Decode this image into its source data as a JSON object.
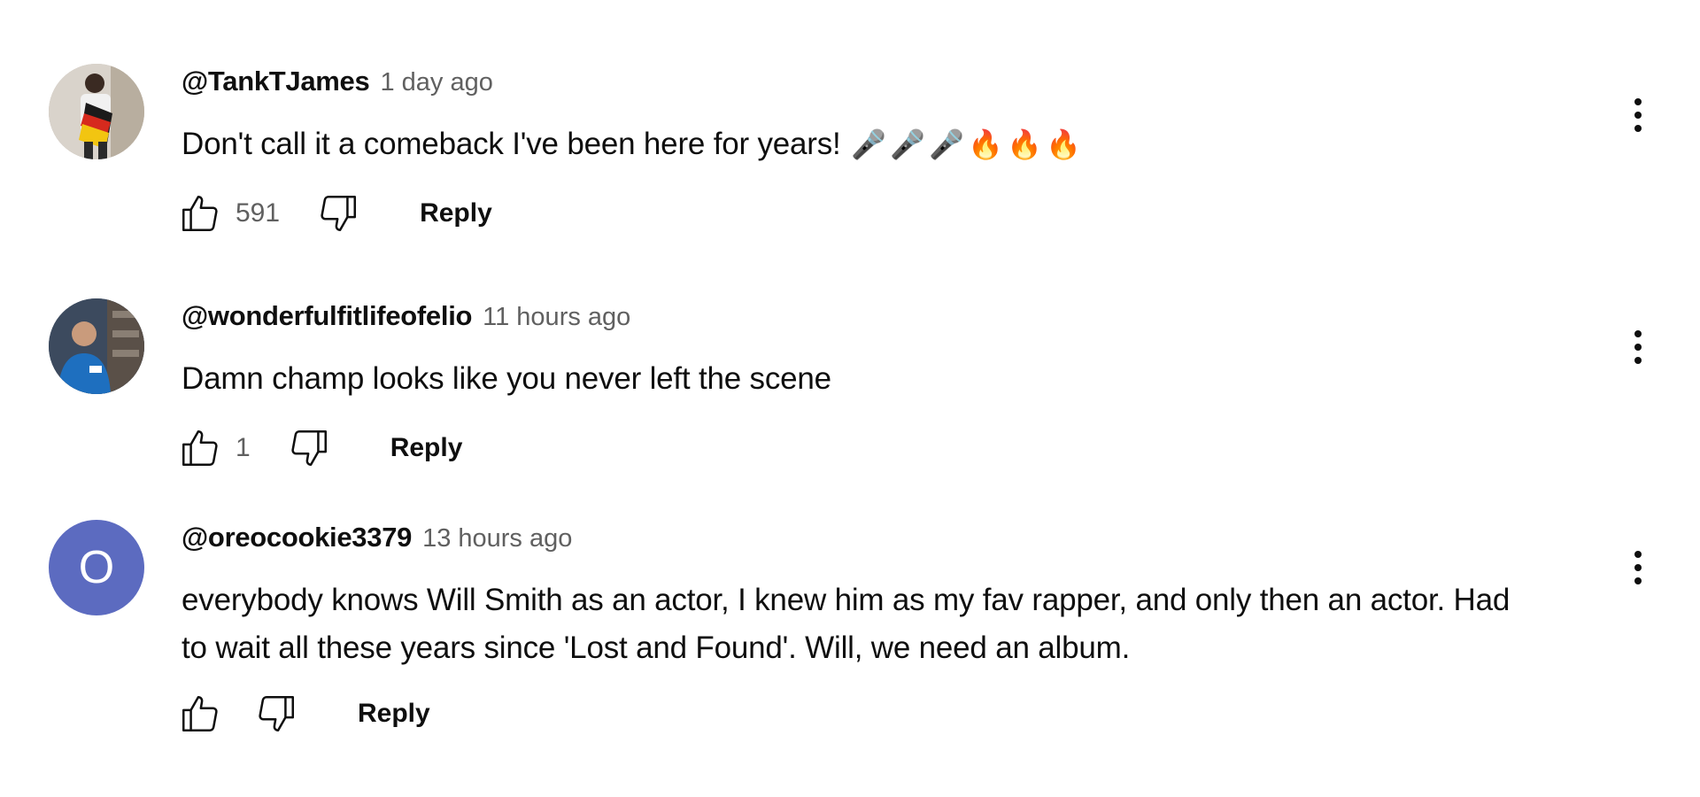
{
  "comments": [
    {
      "author": "@TankTJames",
      "time": "1 day ago",
      "text": "Don't call it a comeback I've been here for years!",
      "emojis": {
        "mic": "🎤",
        "fire": "🔥"
      },
      "likes": "591",
      "reply_label": "Reply",
      "avatar": {
        "type": "photo"
      }
    },
    {
      "author": "@wonderfulfitlifeofelio",
      "time": "11 hours ago",
      "text": "Damn champ looks like you never left the scene",
      "likes": "1",
      "reply_label": "Reply",
      "avatar": {
        "type": "photo"
      }
    },
    {
      "author": "@oreocookie3379",
      "time": "13 hours ago",
      "text_line1": "everybody knows Will Smith as an actor, I knew him as my fav rapper, and only then an actor. Had",
      "text_line2": "to wait all these years since 'Lost and Found'. Will, we need an album.",
      "likes": "",
      "reply_label": "Reply",
      "avatar": {
        "type": "letter",
        "letter": "O",
        "color": "#5c6bc0"
      }
    }
  ],
  "icons": {
    "like": "thumbs-up-icon",
    "dislike": "thumbs-down-icon",
    "menu": "more-vert-icon"
  }
}
